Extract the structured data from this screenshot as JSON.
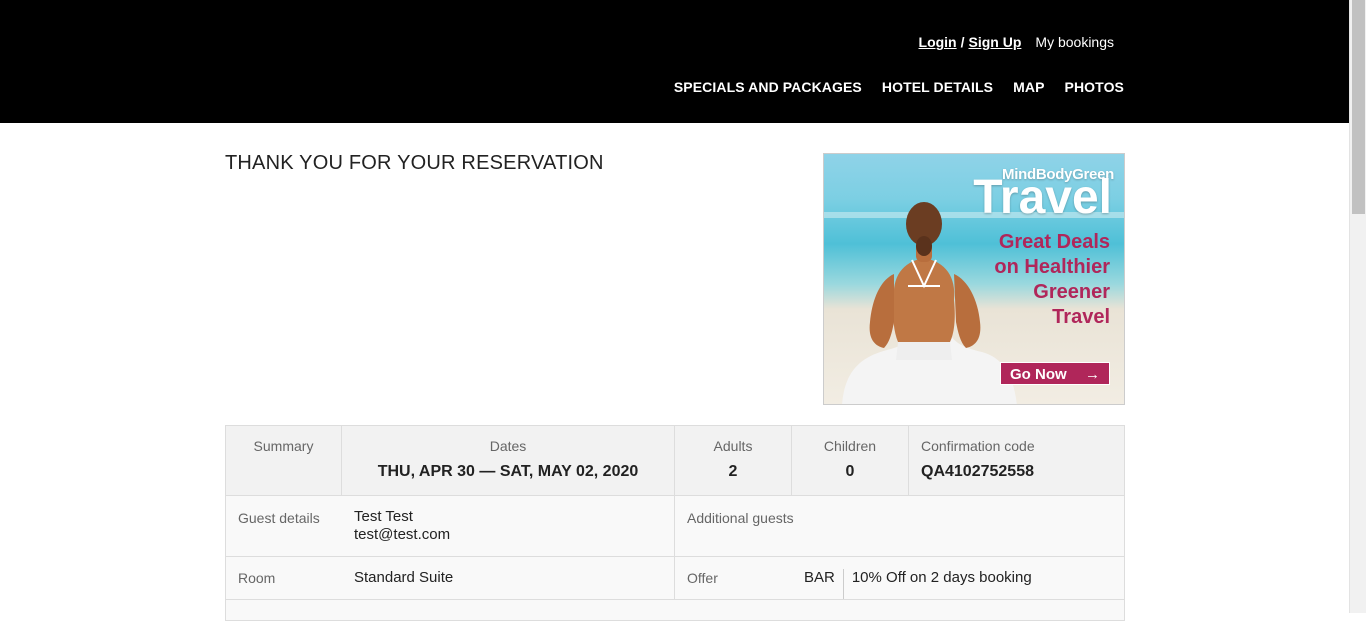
{
  "header": {
    "login": "Login",
    "separator": "/",
    "signup": "Sign Up",
    "my_bookings": "My bookings",
    "nav": [
      "SPECIALS AND PACKAGES",
      "HOTEL DETAILS",
      "MAP",
      "PHOTOS"
    ]
  },
  "page": {
    "title": "THANK YOU FOR YOUR RESERVATION"
  },
  "ad": {
    "brand": "MindBodyGreen",
    "headline": "Travel",
    "tagline": [
      "Great Deals",
      "on Healthier",
      "Greener",
      "Travel"
    ],
    "cta": "Go Now",
    "cta_arrow": "→"
  },
  "summary": {
    "summary_label": "Summary",
    "dates_label": "Dates",
    "dates_value": "THU, APR 30 — SAT, MAY 02, 2020",
    "adults_label": "Adults",
    "adults_value": "2",
    "children_label": "Children",
    "children_value": "0",
    "confirmation_label": "Confirmation code",
    "confirmation_value": "QA4102752558",
    "guest_label": "Guest details",
    "guest_name": "Test Test",
    "guest_email": "test@test.com",
    "additional_label": "Additional guests",
    "room_label": "Room",
    "room_value": "Standard Suite",
    "offer_label": "Offer",
    "offer_code": "BAR",
    "offer_value": "10% Off on 2 days booking"
  }
}
